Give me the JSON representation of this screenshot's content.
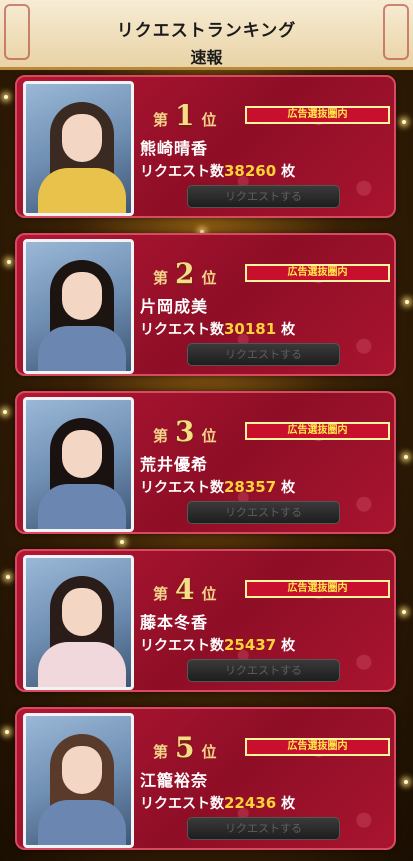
{
  "header": {
    "title": "リクエストランキング",
    "subtitle": "速報"
  },
  "labels": {
    "rank_prefix": "第",
    "rank_suffix": "位",
    "count_label": "リクエスト数",
    "count_unit": "枚"
  },
  "cards": [
    {
      "rank": "1",
      "badge": "広告選抜圏内",
      "name": "熊崎晴香",
      "count": "38260",
      "button": "リクエストする"
    },
    {
      "rank": "2",
      "badge": "広告選抜圏内",
      "name": "片岡成美",
      "count": "30181",
      "button": "リクエストする"
    },
    {
      "rank": "3",
      "badge": "広告選抜圏内",
      "name": "荒井優希",
      "count": "28357",
      "button": "リクエストする"
    },
    {
      "rank": "4",
      "badge": "広告選抜圏内",
      "name": "藤本冬香",
      "count": "25437",
      "button": "リクエストする"
    },
    {
      "rank": "5",
      "badge": "広告選抜圏内",
      "name": "江籠裕奈",
      "count": "22436",
      "button": "リクエストする"
    }
  ]
}
